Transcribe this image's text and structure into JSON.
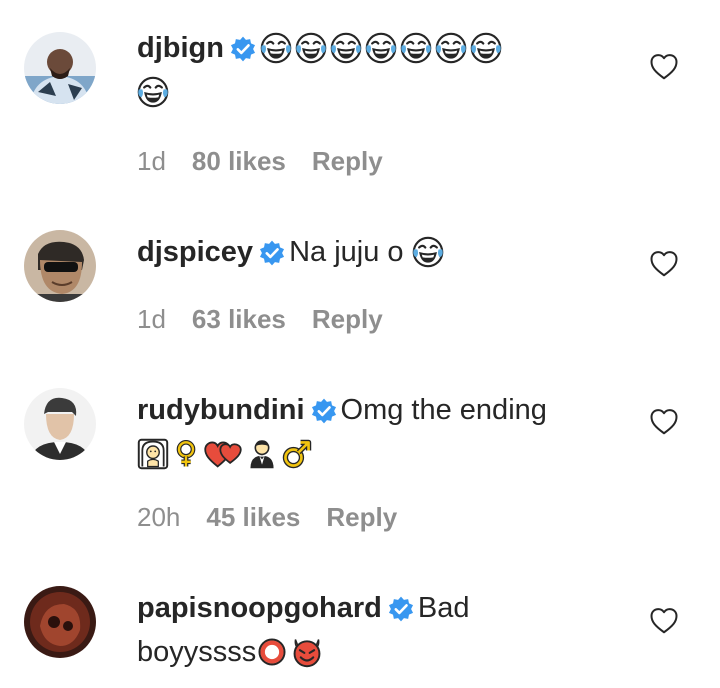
{
  "comments": [
    {
      "username": "djbign",
      "verified": true,
      "text": "",
      "emojis": [
        "face-with-tears-of-joy",
        "face-with-tears-of-joy",
        "face-with-tears-of-joy",
        "face-with-tears-of-joy",
        "face-with-tears-of-joy",
        "face-with-tears-of-joy",
        "face-with-tears-of-joy",
        "face-with-tears-of-joy"
      ],
      "time": "1d",
      "likes": "80 likes",
      "reply": "Reply"
    },
    {
      "username": "djspicey",
      "verified": true,
      "text": "Na juju o",
      "emojis": [
        "face-with-tears-of-joy"
      ],
      "time": "1d",
      "likes": "63 likes",
      "reply": "Reply"
    },
    {
      "username": "rudybundini",
      "verified": true,
      "text": "Omg the ending",
      "emojis": [
        "bride-with-veil",
        "female-sign",
        "two-hearts",
        "man-in-tuxedo",
        "male-sign"
      ],
      "time": "20h",
      "likes": "45 likes",
      "reply": "Reply"
    },
    {
      "username": "papisnoopgohard",
      "verified": true,
      "text_line1": "Bad",
      "text_line2": "boyyssss",
      "emojis": [
        "hollow-red-circle",
        "smiling-face-with-horns"
      ]
    }
  ],
  "colors": {
    "verified": "#3897f0",
    "meta": "#8e8e8e",
    "text": "#262626"
  }
}
